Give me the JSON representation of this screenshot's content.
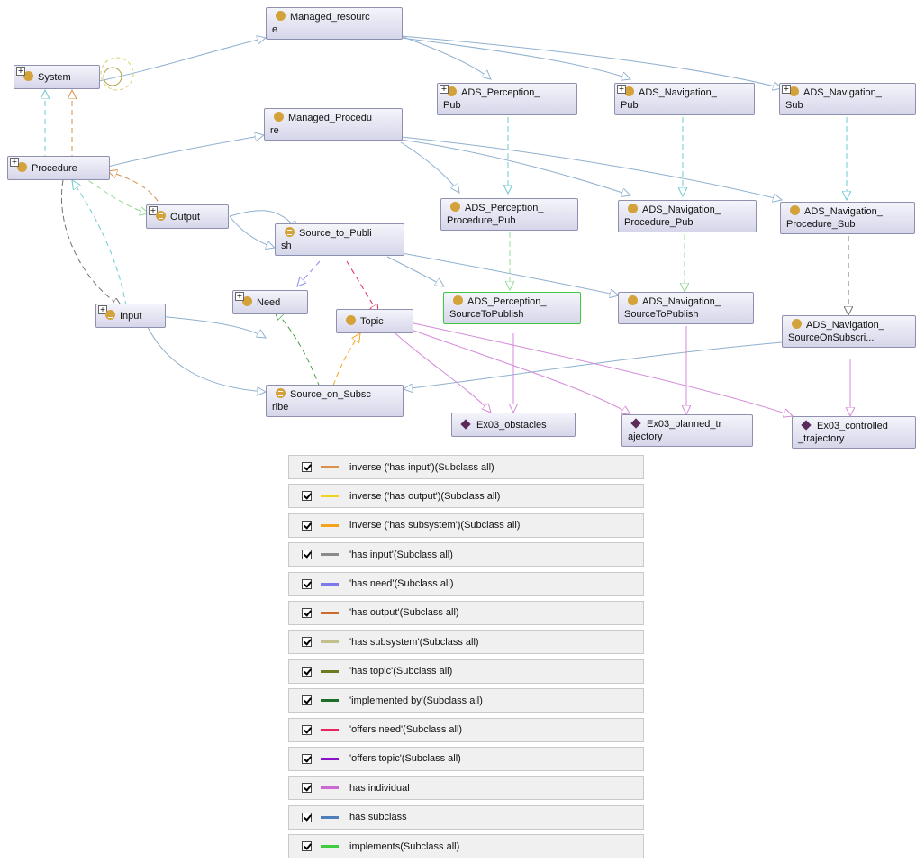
{
  "nodes": {
    "managed_resource": "Managed_resourc\ne",
    "system": "System",
    "ads_perception_pub": "ADS_Perception_\nPub",
    "ads_navigation_pub": "ADS_Navigation_\nPub",
    "ads_navigation_sub": "ADS_Navigation_\nSub",
    "managed_procedure": "Managed_Procedu\nre",
    "procedure": "Procedure",
    "output": "Output",
    "source_to_publish": "Source_to_Publi\nsh",
    "ads_perception_procedure_pub": "ADS_Perception_\nProcedure_Pub",
    "ads_navigation_procedure_pub": "ADS_Navigation_\nProcedure_Pub",
    "ads_navigation_procedure_sub": "ADS_Navigation_\nProcedure_Sub",
    "need": "Need",
    "input": "Input",
    "topic": "Topic",
    "ads_perception_sourcetopublish": "ADS_Perception_\nSourceToPublish",
    "ads_navigation_sourcetopublish": "ADS_Navigation_\nSourceToPublish",
    "ads_navigation_sourceonsubscri": "ADS_Navigation_\nSourceOnSubscri...",
    "source_on_subscribe": "Source_on_Subsc\nribe",
    "ex03_obstacles": "Ex03_obstacles",
    "ex03_planned_trajectory": "Ex03_planned_tr\najectory",
    "ex03_controlled_trajectory": "Ex03_controlled\n_trajectory"
  },
  "icons": {
    "expand": "plus-box-icon",
    "class": "class-circle-icon",
    "equivalent_class": "equivalent-class-icon",
    "individual": "individual-diamond-icon",
    "checkbox": "checked-checkbox-icon"
  },
  "legend": [
    {
      "label": "inverse ('has input')(Subclass all)",
      "color": "#d9914c"
    },
    {
      "label": "inverse ('has output')(Subclass all)",
      "color": "#f2d21a"
    },
    {
      "label": "inverse ('has subsystem')(Subclass all)",
      "color": "#f5a21e"
    },
    {
      "label": "'has input'(Subclass all)",
      "color": "#8a8a8a"
    },
    {
      "label": "'has need'(Subclass all)",
      "color": "#7a7ae8"
    },
    {
      "label": "'has output'(Subclass all)",
      "color": "#cc6a2a"
    },
    {
      "label": "'has subsystem'(Subclass all)",
      "color": "#c2c08a"
    },
    {
      "label": "'has topic'(Subclass all)",
      "color": "#6e7a1e"
    },
    {
      "label": "'implemented by'(Subclass all)",
      "color": "#1e6e2a"
    },
    {
      "label": "'offers need'(Subclass all)",
      "color": "#e8245a"
    },
    {
      "label": "'offers topic'(Subclass all)",
      "color": "#8a12c8"
    },
    {
      "label": "has individual",
      "color": "#cc6ad2"
    },
    {
      "label": "has subclass",
      "color": "#4d7fb8"
    },
    {
      "label": "implements(Subclass all)",
      "color": "#3fcc3f"
    }
  ]
}
